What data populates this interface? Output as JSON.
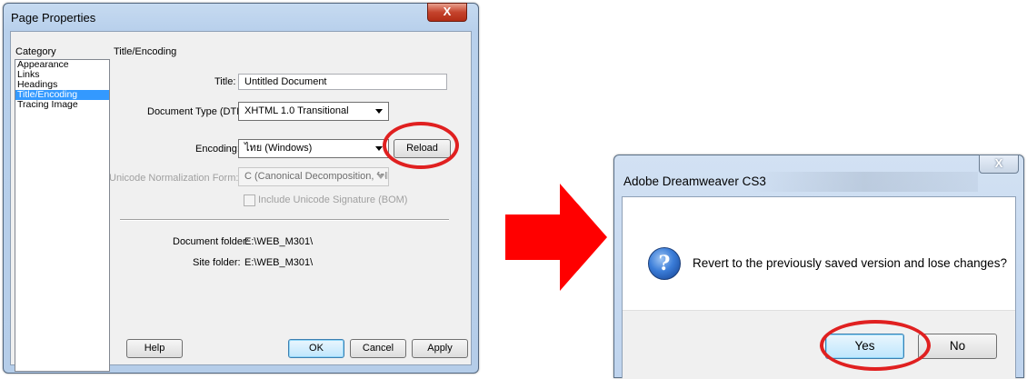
{
  "page_properties": {
    "title": "Page Properties",
    "close_glyph": "X",
    "category_heading": "Category",
    "categories": [
      "Appearance",
      "Links",
      "Headings",
      "Title/Encoding",
      "Tracing Image"
    ],
    "selected_category": "Title/Encoding",
    "section_heading": "Title/Encoding",
    "title_label": "Title:",
    "title_value": "Untitled Document",
    "doctype_label": "Document Type (DTD):",
    "doctype_value": "XHTML 1.0 Transitional",
    "encoding_label": "Encoding:",
    "encoding_value": "ไทย (Windows)",
    "reload_label": "Reload",
    "normalization_label": "Unicode Normalization Form:",
    "normalization_value": "C (Canonical Decomposition, follow",
    "bom_label": "Include Unicode Signature (BOM)",
    "doc_folder_label": "Document folder:",
    "doc_folder_value": "E:\\WEB_M301\\",
    "site_folder_label": "Site folder:",
    "site_folder_value": "E:\\WEB_M301\\",
    "help_label": "Help",
    "ok_label": "OK",
    "cancel_label": "Cancel",
    "apply_label": "Apply"
  },
  "confirm_dialog": {
    "title": "Adobe Dreamweaver CS3",
    "close_glyph": "X",
    "icon": "question-icon",
    "icon_glyph": "?",
    "message": "Revert to the previously saved version and lose changes?",
    "yes_label": "Yes",
    "no_label": "No"
  },
  "colors": {
    "highlight_ring": "#e02020",
    "arrow": "#ff0000",
    "selection": "#3399ff"
  }
}
